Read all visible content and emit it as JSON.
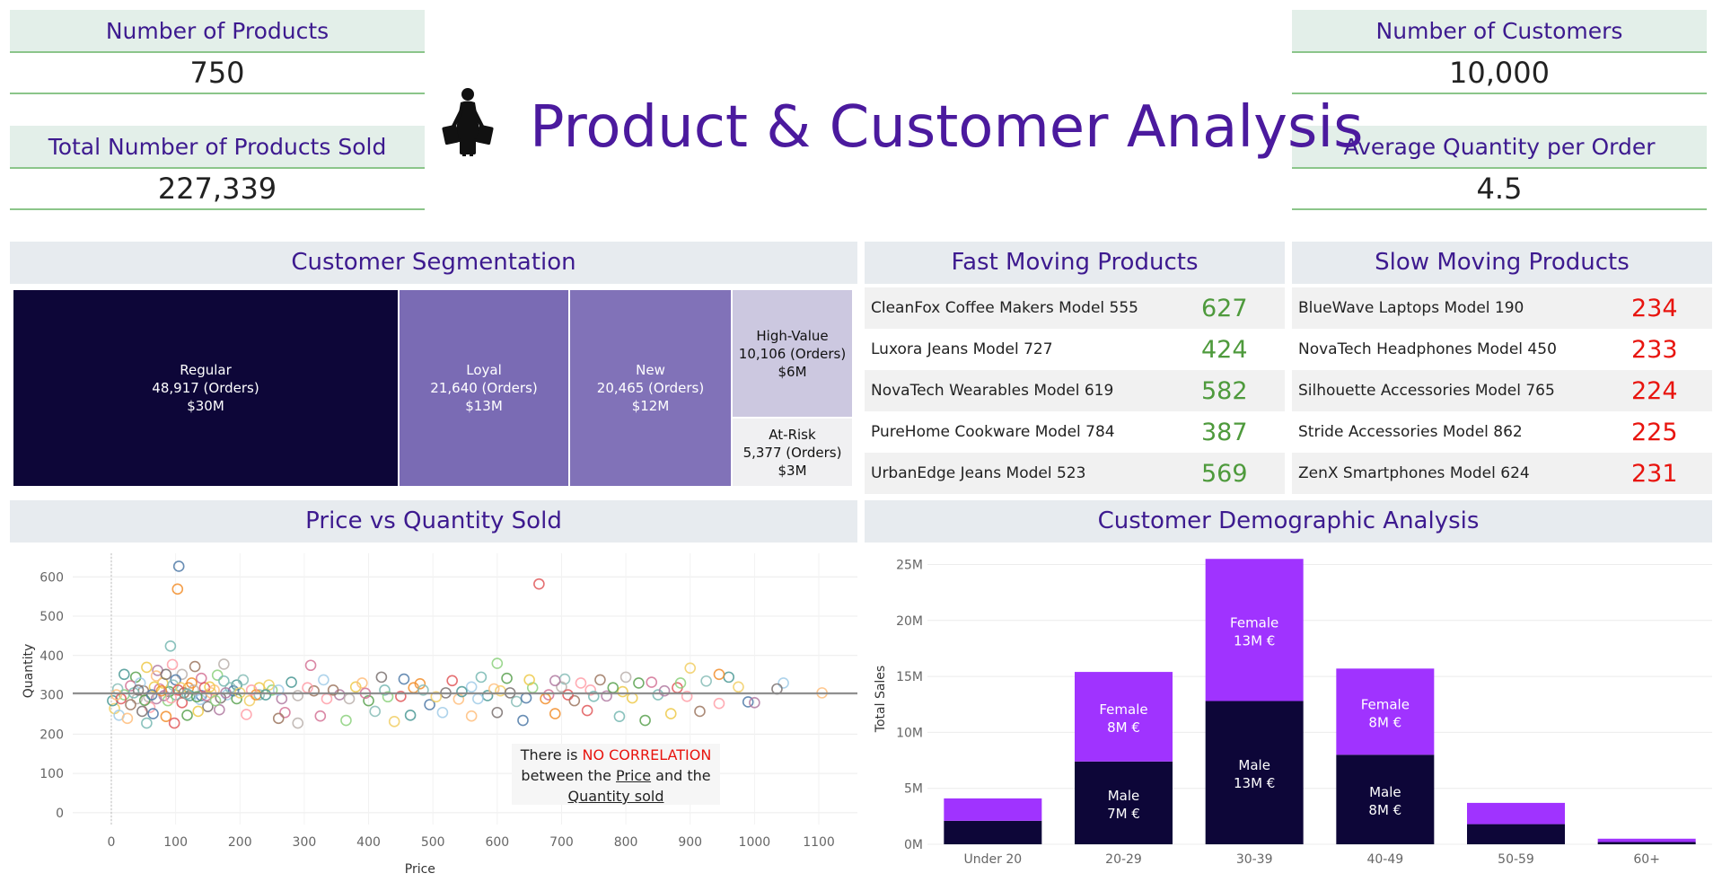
{
  "kpis": {
    "products": {
      "title": "Number of Products",
      "value": "750"
    },
    "sold": {
      "title": "Total Number of Products Sold",
      "value": "227,339"
    },
    "customers": {
      "title": "Number of Customers",
      "value": "10,000"
    },
    "avg_qty": {
      "title": "Average Quantity per Order",
      "value": "4.5"
    }
  },
  "header": {
    "title": "Product & Customer Analysis",
    "icon": "shopper-icon"
  },
  "segmentation": {
    "title": "Customer Segmentation",
    "segments": [
      {
        "name": "Regular",
        "orders": "48,917 (Orders)",
        "sales": "$30M",
        "color": "#0d0638"
      },
      {
        "name": "Loyal",
        "orders": "21,640 (Orders)",
        "sales": "$13M",
        "color": "#7a6bb4"
      },
      {
        "name": "New",
        "orders": "20,465 (Orders)",
        "sales": "$12M",
        "color": "#8172b8"
      },
      {
        "name": "High-Value",
        "orders": "10,106 (Orders)",
        "sales": "$6M",
        "color": "#ccc8e0"
      },
      {
        "name": "At-Risk",
        "orders": "5,377 (Orders)",
        "sales": "$3M",
        "color": "#f0f0f2"
      }
    ]
  },
  "fast": {
    "title": "Fast Moving Products",
    "color": "#4e9a3c",
    "items": [
      {
        "name": "CleanFox Coffee Makers Model 555",
        "value": "627"
      },
      {
        "name": "Luxora Jeans Model 727",
        "value": "424"
      },
      {
        "name": "NovaTech Wearables Model 619",
        "value": "582"
      },
      {
        "name": "PureHome Cookware Model 784",
        "value": "387"
      },
      {
        "name": "UrbanEdge Jeans Model 523",
        "value": "569"
      }
    ]
  },
  "slow": {
    "title": "Slow Moving Products",
    "color": "#e8140e",
    "items": [
      {
        "name": "BlueWave Laptops Model 190",
        "value": "234"
      },
      {
        "name": "NovaTech Headphones Model 450",
        "value": "233"
      },
      {
        "name": "Silhouette Accessories Model 765",
        "value": "224"
      },
      {
        "name": "Stride Accessories Model 862",
        "value": "225"
      },
      {
        "name": "ZenX Smartphones Model 624",
        "value": "231"
      }
    ]
  },
  "scatter": {
    "title": "Price vs Quantity Sold",
    "note": {
      "l1a": "There is ",
      "l1b": "NO CORRELATION",
      "l2a": "between the ",
      "l2b": "Price",
      "l2c": " and the",
      "l3": "Quantity sold"
    }
  },
  "demographic": {
    "title": "Customer Demographic Analysis"
  },
  "chart_data": [
    {
      "type": "scatter",
      "title": "Price vs Quantity Sold",
      "xlabel": "Price",
      "ylabel": "Quantity",
      "xlim": [
        -60,
        1160
      ],
      "ylim": [
        -30,
        660
      ],
      "xticks": [
        0,
        100,
        200,
        300,
        400,
        500,
        600,
        700,
        800,
        900,
        1000,
        1100
      ],
      "yticks": [
        0,
        100,
        200,
        300,
        400,
        500,
        600
      ],
      "trend_line_y": 304,
      "grid": true,
      "points": [
        [
          105,
          627
        ],
        [
          103,
          569
        ],
        [
          665,
          582
        ],
        [
          92,
          424
        ],
        [
          38,
          345
        ],
        [
          55,
          370
        ],
        [
          72,
          362
        ],
        [
          95,
          377
        ],
        [
          130,
          372
        ],
        [
          175,
          378
        ],
        [
          310,
          375
        ],
        [
          600,
          380
        ],
        [
          705,
          340
        ],
        [
          900,
          368
        ],
        [
          960,
          345
        ],
        [
          1045,
          330
        ],
        [
          1105,
          305
        ],
        [
          1035,
          315
        ],
        [
          990,
          282
        ],
        [
          945,
          352
        ],
        [
          880,
          318
        ],
        [
          850,
          300
        ],
        [
          820,
          330
        ],
        [
          795,
          308
        ],
        [
          770,
          297
        ],
        [
          745,
          312
        ],
        [
          720,
          285
        ],
        [
          700,
          320
        ],
        [
          680,
          300
        ],
        [
          655,
          318
        ],
        [
          630,
          283
        ],
        [
          605,
          310
        ],
        [
          585,
          298
        ],
        [
          560,
          320
        ],
        [
          540,
          289
        ],
        [
          520,
          305
        ],
        [
          495,
          275
        ],
        [
          470,
          318
        ],
        [
          450,
          296
        ],
        [
          425,
          312
        ],
        [
          400,
          285
        ],
        [
          380,
          320
        ],
        [
          355,
          300
        ],
        [
          335,
          290
        ],
        [
          315,
          310
        ],
        [
          290,
          298
        ],
        [
          270,
          255
        ],
        [
          250,
          312
        ],
        [
          230,
          300
        ],
        [
          215,
          285
        ],
        [
          195,
          325
        ],
        [
          180,
          300
        ],
        [
          160,
          312
        ],
        [
          150,
          270
        ],
        [
          140,
          298
        ],
        [
          120,
          318
        ],
        [
          110,
          280
        ],
        [
          100,
          300
        ],
        [
          90,
          308
        ],
        [
          80,
          330
        ],
        [
          70,
          290
        ],
        [
          60,
          268
        ],
        [
          50,
          310
        ],
        [
          40,
          290
        ],
        [
          30,
          323
        ],
        [
          20,
          300
        ],
        [
          10,
          315
        ],
        [
          5,
          265
        ],
        [
          2,
          285
        ],
        [
          12,
          248
        ],
        [
          25,
          240
        ],
        [
          48,
          258
        ],
        [
          65,
          252
        ],
        [
          85,
          245
        ],
        [
          98,
          228
        ],
        [
          55,
          228
        ],
        [
          118,
          248
        ],
        [
          135,
          258
        ],
        [
          168,
          262
        ],
        [
          210,
          250
        ],
        [
          260,
          240
        ],
        [
          290,
          228
        ],
        [
          325,
          246
        ],
        [
          365,
          235
        ],
        [
          410,
          258
        ],
        [
          440,
          232
        ],
        [
          465,
          248
        ],
        [
          515,
          255
        ],
        [
          560,
          246
        ],
        [
          600,
          255
        ],
        [
          640,
          235
        ],
        [
          690,
          252
        ],
        [
          740,
          260
        ],
        [
          790,
          245
        ],
        [
          830,
          235
        ],
        [
          870,
          252
        ],
        [
          1000,
          280
        ],
        [
          945,
          278
        ],
        [
          915,
          258
        ],
        [
          110,
          352
        ],
        [
          140,
          342
        ],
        [
          165,
          350
        ],
        [
          205,
          338
        ],
        [
          245,
          325
        ],
        [
          280,
          332
        ],
        [
          330,
          338
        ],
        [
          390,
          330
        ],
        [
          420,
          345
        ],
        [
          455,
          340
        ],
        [
          480,
          328
        ],
        [
          530,
          336
        ],
        [
          575,
          345
        ],
        [
          615,
          342
        ],
        [
          650,
          338
        ],
        [
          690,
          336
        ],
        [
          730,
          330
        ],
        [
          760,
          338
        ],
        [
          800,
          345
        ],
        [
          840,
          332
        ],
        [
          885,
          330
        ],
        [
          925,
          335
        ],
        [
          975,
          320
        ],
        [
          20,
          352
        ],
        [
          45,
          330
        ],
        [
          70,
          348
        ],
        [
          85,
          352
        ],
        [
          100,
          338
        ],
        [
          125,
          330
        ],
        [
          145,
          318
        ],
        [
          175,
          335
        ],
        [
          195,
          290
        ],
        [
          230,
          318
        ],
        [
          265,
          290
        ],
        [
          305,
          318
        ],
        [
          345,
          312
        ],
        [
          370,
          290
        ],
        [
          395,
          304
        ],
        [
          430,
          295
        ],
        [
          485,
          312
        ],
        [
          505,
          295
        ],
        [
          545,
          308
        ],
        [
          570,
          290
        ],
        [
          595,
          315
        ],
        [
          620,
          305
        ],
        [
          645,
          292
        ],
        [
          675,
          290
        ],
        [
          710,
          300
        ],
        [
          750,
          296
        ],
        [
          780,
          318
        ],
        [
          810,
          292
        ],
        [
          860,
          310
        ],
        [
          895,
          296
        ],
        [
          30,
          275
        ],
        [
          58,
          295
        ],
        [
          75,
          315
        ],
        [
          88,
          285
        ],
        [
          96,
          325
        ],
        [
          108,
          318
        ],
        [
          122,
          298
        ],
        [
          138,
          288
        ],
        [
          155,
          305
        ],
        [
          170,
          292
        ],
        [
          190,
          310
        ],
        [
          225,
          300
        ],
        [
          15,
          290
        ],
        [
          35,
          305
        ],
        [
          52,
          286
        ],
        [
          67,
          320
        ],
        [
          82,
          298
        ],
        [
          93,
          292
        ],
        [
          113,
          305
        ],
        [
          128,
          312
        ],
        [
          148,
          298
        ],
        [
          162,
          285
        ],
        [
          185,
          318
        ],
        [
          200,
          305
        ],
        [
          240,
          300
        ],
        [
          260,
          312
        ],
        [
          8,
          300
        ],
        [
          42,
          312
        ],
        [
          63,
          300
        ],
        [
          78,
          310
        ],
        [
          104,
          312
        ],
        [
          118,
          302
        ],
        [
          133,
          295
        ],
        [
          153,
          320
        ],
        [
          178,
          305
        ],
        [
          218,
          312
        ]
      ]
    },
    {
      "type": "bar",
      "title": "Customer Demographic Analysis",
      "xlabel": "",
      "ylabel": "Total Sales",
      "ylim": [
        0,
        26
      ],
      "yticks": [
        "0M",
        "5M",
        "10M",
        "15M",
        "20M",
        "25M"
      ],
      "categories": [
        "Under 20",
        "20-29",
        "30-39",
        "40-49",
        "50-59",
        "60+"
      ],
      "stacked": true,
      "series": [
        {
          "name": "Male",
          "color": "#0d0638",
          "values": [
            2.1,
            7.4,
            12.8,
            8.0,
            1.8,
            0.2
          ],
          "labels": [
            "",
            "Male\n7M €",
            "Male\n13M €",
            "Male\n8M €",
            "",
            ""
          ]
        },
        {
          "name": "Female",
          "color": "#a033ff",
          "values": [
            2.0,
            8.0,
            12.7,
            7.7,
            1.9,
            0.3
          ],
          "labels": [
            "",
            "Female\n8M €",
            "Female\n13M €",
            "Female\n8M €",
            "",
            ""
          ]
        }
      ]
    }
  ]
}
